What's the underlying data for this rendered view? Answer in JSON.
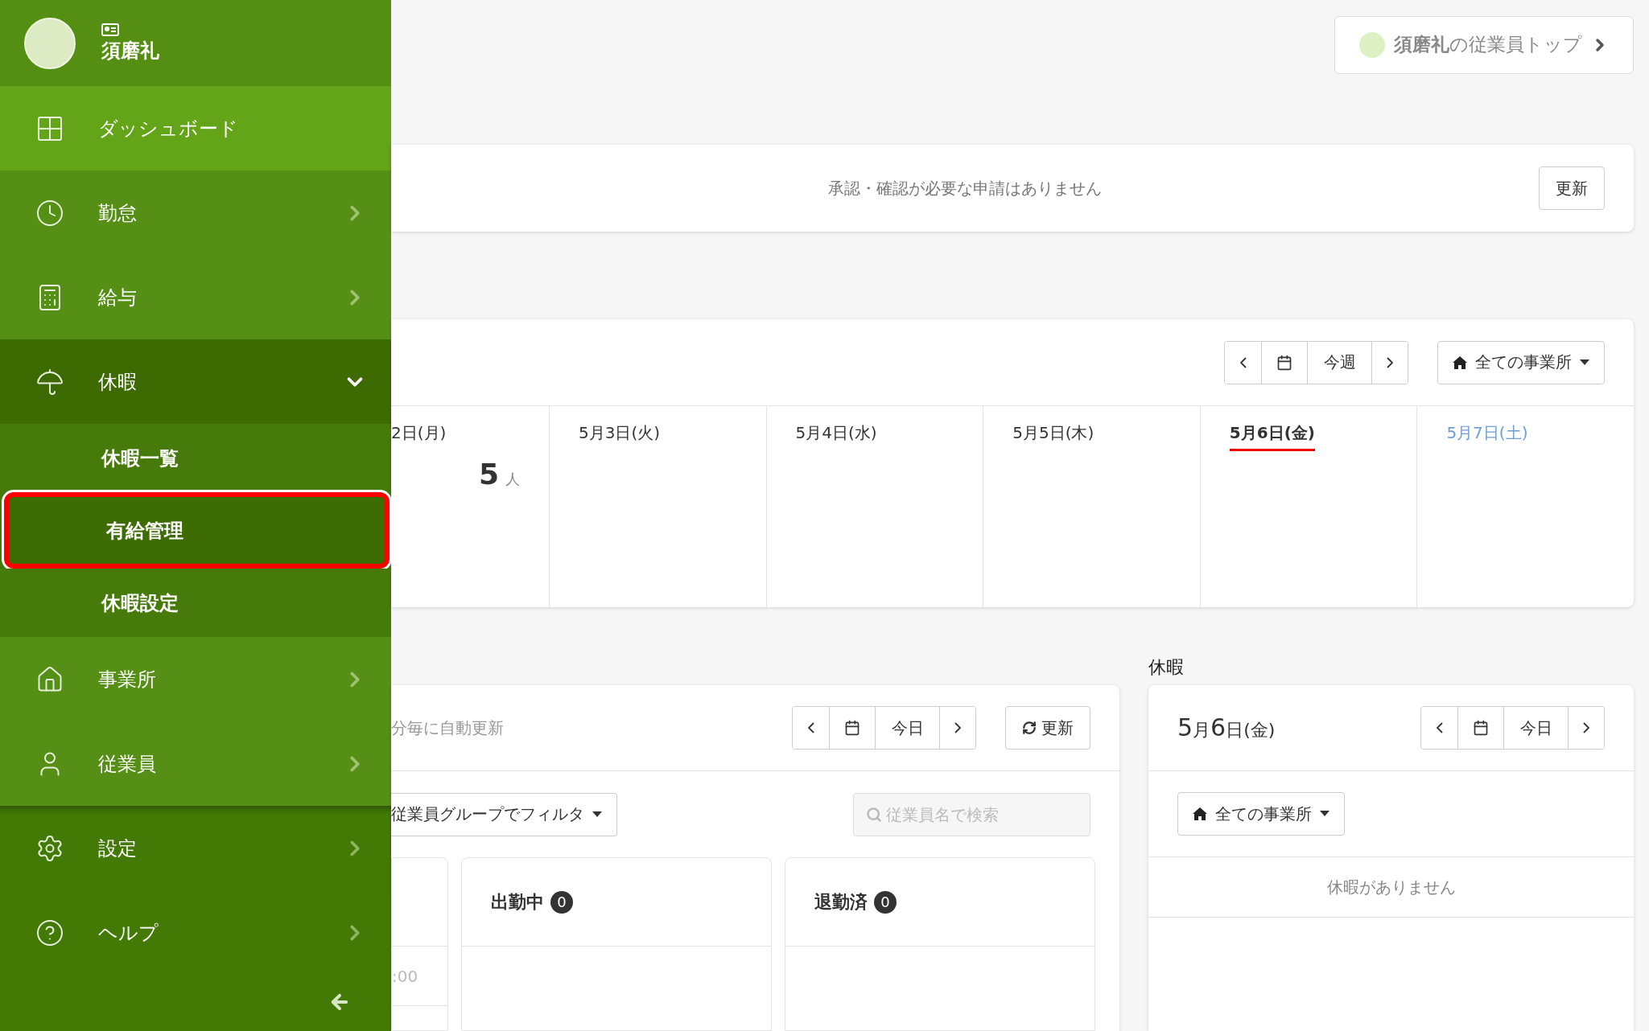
{
  "user": {
    "name": "須磨礼"
  },
  "sidebar": {
    "items": [
      {
        "label": "ダッシュボード",
        "selected": true,
        "has_arrow": false
      },
      {
        "label": "勤怠",
        "selected": false,
        "has_arrow": true
      },
      {
        "label": "給与",
        "selected": false,
        "has_arrow": true
      },
      {
        "label": "休暇",
        "selected": false,
        "expanded": true,
        "children": [
          {
            "label": "休暇一覧",
            "selected": false
          },
          {
            "label": "有給管理",
            "selected": true
          },
          {
            "label": "休暇設定",
            "selected": false
          }
        ]
      },
      {
        "label": "事業所",
        "selected": false,
        "has_arrow": true
      },
      {
        "label": "従業員",
        "selected": false,
        "has_arrow": true
      }
    ],
    "footer_items": [
      {
        "label": "設定",
        "selected": false
      },
      {
        "label": "ヘルプ",
        "selected": false
      }
    ]
  },
  "top_button": {
    "name": "須磨礼",
    "suffix": "の従業員トップ"
  },
  "requests": {
    "message": "承認・確認が必要な申請はありません",
    "button": "更新"
  },
  "week": {
    "nav_label": "今週",
    "office_filter": "全ての事業所",
    "days": [
      {
        "label": "2日(月)",
        "kind": "normal",
        "count": "5",
        "unit": "人"
      },
      {
        "label": "5月3日(火)",
        "kind": "normal"
      },
      {
        "label": "5月4日(水)",
        "kind": "normal"
      },
      {
        "label": "5月5日(木)",
        "kind": "normal"
      },
      {
        "label": "5月6日(金)",
        "kind": "today"
      },
      {
        "label": "5月7日(土)",
        "kind": "saturday"
      }
    ]
  },
  "attendance": {
    "auto_refresh": "分毎に自動更新",
    "nav_label": "今日",
    "refresh": "更新",
    "group_filter": "従業員グループでフィルタ",
    "search": {
      "placeholder": "従業員名で検索"
    },
    "columns": [
      {
        "row": ":00"
      },
      {
        "title": "出勤中",
        "count": "0"
      },
      {
        "title": "退勤済",
        "count": "0"
      }
    ]
  },
  "leave": {
    "heading": "休暇",
    "date_num1": "5",
    "date_m": "月",
    "date_num2": "6",
    "date_rest": "日(金)",
    "nav_label": "今日",
    "office_filter": "全ての事業所",
    "empty": "休暇がありません"
  }
}
